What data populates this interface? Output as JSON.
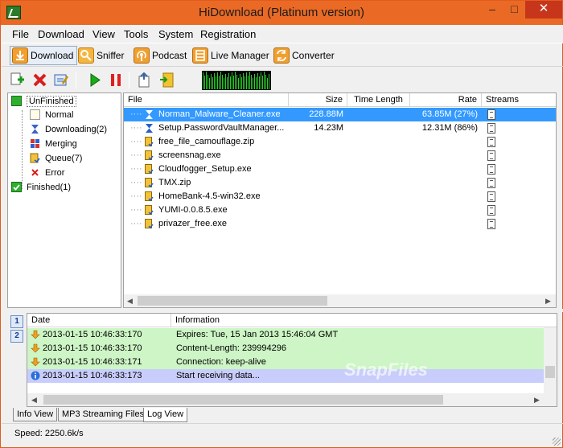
{
  "window": {
    "title": "HiDownload (Platinum version)",
    "min": "–",
    "max": "□",
    "close": "✕"
  },
  "menu": [
    "File",
    "Download",
    "View",
    "Tools",
    "System",
    "Registration"
  ],
  "toolbar": {
    "download": "Download",
    "sniffer": "Sniffer",
    "podcast": "Podcast",
    "live_manager": "Live Manager",
    "converter": "Converter"
  },
  "tree": {
    "unfinished": "UnFinished",
    "normal": "Normal",
    "downloading": "Downloading(2)",
    "merging": "Merging",
    "queue": "Queue(7)",
    "error": "Error",
    "finished": "Finished(1)"
  },
  "grid": {
    "headers": {
      "file": "File",
      "size": "Size",
      "time_length": "Time Length",
      "rate": "Rate",
      "streams": "Streams"
    },
    "rows": [
      {
        "file": "Norman_Malware_Cleaner.exe",
        "size": "228.88M",
        "rate": "63.85M (27%)",
        "state": "downloading"
      },
      {
        "file": "Setup.PasswordVaultManager...",
        "size": "14.23M",
        "rate": "12.31M (86%)",
        "state": "downloading"
      },
      {
        "file": "free_file_camouflage.zip",
        "size": "",
        "rate": "",
        "state": "queued"
      },
      {
        "file": "screensnag.exe",
        "size": "",
        "rate": "",
        "state": "queued"
      },
      {
        "file": "Cloudfogger_Setup.exe",
        "size": "",
        "rate": "",
        "state": "queued"
      },
      {
        "file": "TMX.zip",
        "size": "",
        "rate": "",
        "state": "queued"
      },
      {
        "file": "HomeBank-4.5-win32.exe",
        "size": "",
        "rate": "",
        "state": "queued"
      },
      {
        "file": "YUMI-0.0.8.5.exe",
        "size": "",
        "rate": "",
        "state": "queued"
      },
      {
        "file": "privazer_free.exe",
        "size": "",
        "rate": "",
        "state": "queued"
      }
    ]
  },
  "log": {
    "tab1": "1",
    "tab2": "2",
    "headers": {
      "date": "Date",
      "information": "Information"
    },
    "rows": [
      {
        "date": "2013-01-15 10:46:33:170",
        "info": "Expires: Tue, 15 Jan 2013 15:46:04 GMT",
        "kind": "arrow"
      },
      {
        "date": "2013-01-15 10:46:33:170",
        "info": "Content-Length: 239994296",
        "kind": "arrow"
      },
      {
        "date": "2013-01-15 10:46:33:171",
        "info": "Connection: keep-alive",
        "kind": "arrow"
      },
      {
        "date": "2013-01-15 10:46:33:173",
        "info": "Start receiving data...",
        "kind": "info"
      }
    ]
  },
  "watermark": "SnapFiles",
  "bottom_tabs": [
    "Info View",
    "MP3 Streaming Files",
    "Log View"
  ],
  "status": "Speed: 2250.6k/s",
  "colors": {
    "titlebar": "#ea6a25",
    "selection": "#3399ff",
    "log_green": "#cdf5c5",
    "log_blue": "#c9cdfb"
  }
}
